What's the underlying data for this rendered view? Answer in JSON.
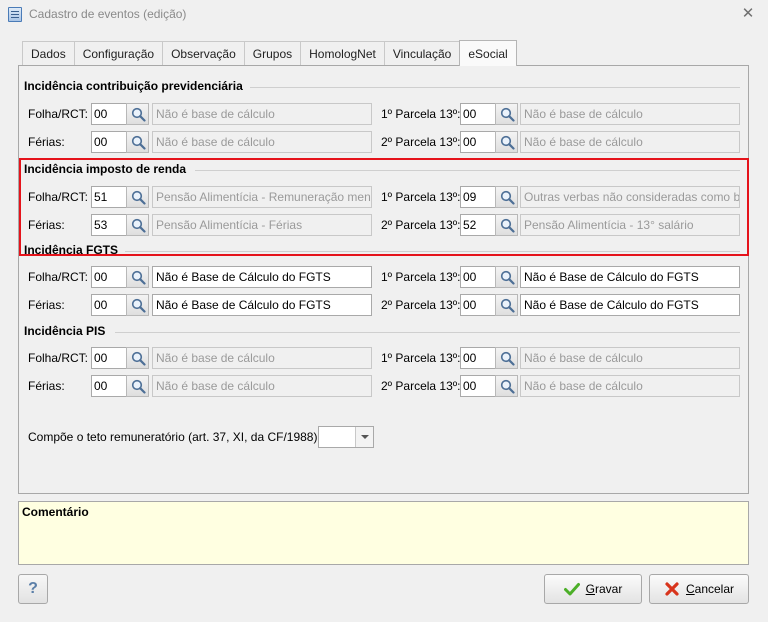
{
  "window": {
    "title": "Cadastro de eventos (edição)",
    "close_glyph": "✕"
  },
  "tabs": [
    "Dados",
    "Configuração",
    "Observação",
    "Grupos",
    "HomologNet",
    "Vinculação",
    "eSocial"
  ],
  "active_tab": "eSocial",
  "sections": {
    "previdenciaria": {
      "title": "Incidência contribuição previdenciária",
      "rows": [
        {
          "left_label": "Folha/RCT:",
          "left_code": "00",
          "left_desc": "Não é base de cálculo",
          "right_label": "1º Parcela 13º:",
          "right_code": "00",
          "right_desc": "Não é base de cálculo"
        },
        {
          "left_label": "Férias:",
          "left_code": "00",
          "left_desc": "Não é base de cálculo",
          "right_label": "2º Parcela 13º:",
          "right_code": "00",
          "right_desc": "Não é base de cálculo"
        }
      ]
    },
    "imposto_renda": {
      "title": "Incidência imposto de renda",
      "rows": [
        {
          "left_label": "Folha/RCT:",
          "left_code": "51",
          "left_desc": "Pensão Alimentícia - Remuneração mensal",
          "right_label": "1º Parcela 13º:",
          "right_code": "09",
          "right_desc": "Outras verbas não consideradas como base de cálculo"
        },
        {
          "left_label": "Férias:",
          "left_code": "53",
          "left_desc": "Pensão Alimentícia - Férias",
          "right_label": "2º Parcela 13º:",
          "right_code": "52",
          "right_desc": "Pensão Alimentícia - 13° salário"
        }
      ]
    },
    "fgts": {
      "title": "Incidência FGTS",
      "rows": [
        {
          "left_label": "Folha/RCT:",
          "left_code": "00",
          "left_desc": "Não é Base de Cálculo do FGTS",
          "right_label": "1º Parcela 13º:",
          "right_code": "00",
          "right_desc": "Não é Base de Cálculo do FGTS"
        },
        {
          "left_label": "Férias:",
          "left_code": "00",
          "left_desc": "Não é Base de Cálculo do FGTS",
          "right_label": "2º Parcela 13º:",
          "right_code": "00",
          "right_desc": "Não é Base de Cálculo do FGTS"
        }
      ]
    },
    "pis": {
      "title": "Incidência PIS",
      "rows": [
        {
          "left_label": "Folha/RCT:",
          "left_code": "00",
          "left_desc": "Não é base de cálculo",
          "right_label": "1º Parcela 13º:",
          "right_code": "00",
          "right_desc": "Não é base de cálculo"
        },
        {
          "left_label": "Férias:",
          "left_code": "00",
          "left_desc": "Não é base de cálculo",
          "right_label": "2º Parcela 13º:",
          "right_code": "00",
          "right_desc": "Não é base de cálculo"
        }
      ]
    }
  },
  "teto": {
    "label": "Compõe o teto remuneratório (art. 37, XI, da CF/1988)",
    "value": ""
  },
  "comment": {
    "label": "Comentário",
    "value": ""
  },
  "buttons": {
    "help": "?",
    "save_prefix": "",
    "save_mnemonic": "G",
    "save_rest": "ravar",
    "cancel_mnemonic": "C",
    "cancel_rest": "ancelar"
  },
  "colors": {
    "highlight": "#e5131b",
    "comment_bg": "#ffffe1",
    "save_icon": "#4caf28",
    "cancel_icon": "#d8341c"
  }
}
